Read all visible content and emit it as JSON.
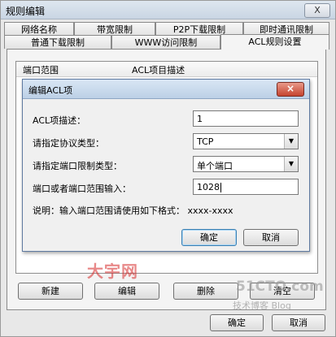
{
  "window": {
    "title": "规则编辑",
    "close": "X"
  },
  "tabs_row1": [
    "网络名称",
    "带宽限制",
    "P2P下载限制",
    "即时通讯限制"
  ],
  "tabs_row2": [
    "普通下载限制",
    "WWW访问限制",
    "ACL规则设置"
  ],
  "active_tab": "ACL规则设置",
  "list": {
    "columns": [
      "端口范围",
      "ACL项目描述"
    ]
  },
  "list_buttons": {
    "new": "新建",
    "edit": "编辑",
    "delete": "删除",
    "clear": "清空"
  },
  "footer": {
    "ok": "确定",
    "cancel": "取消"
  },
  "dialog": {
    "title": "编辑ACL项",
    "close": "×",
    "desc_label": "ACL项描述：",
    "desc_value": "1",
    "protocol_label": "请指定协议类型：",
    "protocol_value": "TCP",
    "port_type_label": "请指定端口限制类型：",
    "port_type_value": "单个端口",
    "port_input_label": "端口或者端口范围输入：",
    "port_input_value": "1028",
    "note": "说明：输入端口范围请使用如下格式：   xxxx-xxxx",
    "ok": "确定",
    "cancel": "取消"
  },
  "watermarks": {
    "red": "大宇网",
    "grey": "51CTO.com",
    "grey2": "技术博客  Blog"
  }
}
